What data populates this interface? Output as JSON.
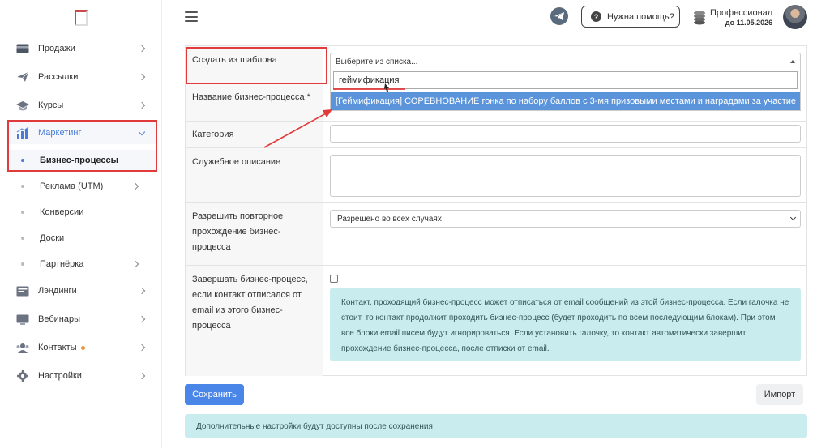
{
  "sidebar": {
    "items": [
      {
        "label": "Продажи",
        "icon": "card-icon"
      },
      {
        "label": "Рассылки",
        "icon": "paper-plane-icon"
      },
      {
        "label": "Курсы",
        "icon": "graduation-cap-icon"
      },
      {
        "label": "Маркетинг",
        "icon": "chart-icon"
      },
      {
        "label": "Лэндинги",
        "icon": "landing-icon"
      },
      {
        "label": "Вебинары",
        "icon": "webinar-icon"
      },
      {
        "label": "Контакты",
        "icon": "users-icon"
      },
      {
        "label": "Настройки",
        "icon": "gear-icon"
      }
    ],
    "sub_items": [
      {
        "label": "Бизнес-процессы"
      },
      {
        "label": "Реклама (UTM)"
      },
      {
        "label": "Конверсии"
      },
      {
        "label": "Доски"
      },
      {
        "label": "Партнёрка"
      }
    ]
  },
  "header": {
    "help_label": "Нужна помощь?",
    "plan_name": "Профессионал",
    "plan_until": "до 11.05.2026"
  },
  "form": {
    "template_label": "Создать из шаблона",
    "template_placeholder": "Выберите из списка...",
    "template_search_value": "геймификация",
    "template_option": "[Геймификация] СОРЕВНОВАНИЕ гонка по набору баллов с 3-мя призовыми местами и наградами за участие",
    "name_label": "Название бизнес-процесса *",
    "category_label": "Категория",
    "description_label": "Служебное описание",
    "repeat_label": "Разрешить повторное прохождение бизнес-процесса",
    "repeat_value": "Разрешено во всех случаях",
    "finish_label": "Завершать бизнес-процесс, если контакт отписался от email из этого бизнес-процесса",
    "finish_checked": false,
    "finish_info": "Контакт, проходящий бизнес-процесс может отписаться от email сообщений из этой бизнес-процесса. Если галочка не стоит, то контакт продолжит проходить бизнес-процесс (будет проходить по всем последующим блокам). При этом все блоки email писем будут игнорироваться. Если установить галочку, то контакт автоматически завершит прохождение бизнес-процесса, после отписки от email."
  },
  "actions": {
    "save_label": "Сохранить",
    "import_label": "Импорт"
  },
  "notice": "Дополнительные настройки будут доступны после сохранения",
  "colors": {
    "accent": "#4a86e8",
    "annotation": "#e03a3a",
    "info_bg": "#c9ecef",
    "badge": "#e8943a"
  }
}
